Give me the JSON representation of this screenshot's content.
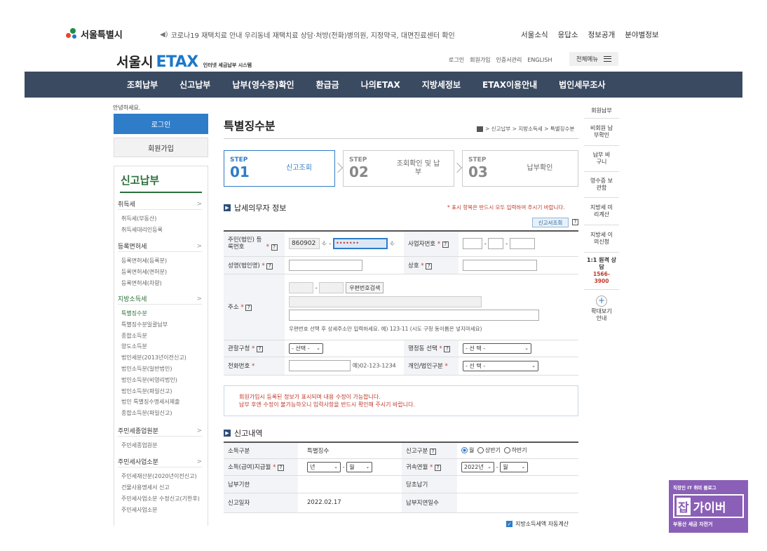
{
  "top": {
    "brand": "서울특별시",
    "notice": "코로나19 재택치료 안내 우리동네 재택치료 상담·처방(전화)병의원, 지정약국, 대면진료센터 확인",
    "nav": [
      "서울소식",
      "응답소",
      "정보공개",
      "분야별정보"
    ]
  },
  "etax": {
    "logo_k": "서울시",
    "logo_e": "ETAX",
    "logo_sub": "인터넷 세금납부 시스템",
    "links": [
      "로그인",
      "회원가입",
      "인증서관리",
      "ENGLISH"
    ],
    "all_menu": "전체메뉴"
  },
  "main_nav": [
    "조회납부",
    "신고납부",
    "납부(영수증)확인",
    "환급금",
    "나의ETAX",
    "지방세정보",
    "ETAX이용안내",
    "법인세무조사"
  ],
  "sidebar": {
    "greeting": "안녕하세요.",
    "login": "로그인",
    "join": "회원가입",
    "title": "신고납부",
    "groups": [
      {
        "label": "취득세",
        "items": [
          "취득세(부동산)",
          "취득세대리인등록"
        ]
      },
      {
        "label": "등록면허세",
        "items": [
          "등록면허세(등록분)",
          "등록면허세(면허분)",
          "등록면허세(차량)"
        ]
      },
      {
        "label": "지방소득세",
        "items": [
          "특별징수분",
          "특별징수분일괄납부",
          "종합소득분",
          "양도소득분",
          "법인세분(2013년이전신고)",
          "법인소득분(일반법인)",
          "법인소득분(비영리법인)",
          "법인소득분(파일신고)",
          "법인 특별징수명세서제출",
          "종합소득분(파일신고)"
        ]
      },
      {
        "label": "주민세종업원분",
        "items": [
          "주민세종업원분"
        ]
      },
      {
        "label": "주민세사업소분",
        "items": [
          "주민세재산분(2020년이전신고)",
          "건물사용명세서 신고",
          "주민세사업소분 수정신고(기한후)",
          "주민세사업소분"
        ]
      }
    ]
  },
  "quick": [
    "회원납부",
    "비회원 납부확인",
    "납부 바구니",
    "영수증 보관함",
    "지방세 미리계산",
    "지방세 이의신청",
    "1:1 원격 상담"
  ],
  "quick_phone": "1566-3900",
  "quick_zoom": "확대보기 안내",
  "content": {
    "title": "특별징수분",
    "breadcrumb": "> 신고납부 > 지방소득세 > 특별징수분",
    "steps": [
      {
        "label": "STEP",
        "num": "01",
        "text": "신고조회"
      },
      {
        "label": "STEP",
        "num": "02",
        "text": "조회확인 및 납부"
      },
      {
        "label": "STEP",
        "num": "03",
        "text": "납부확인"
      }
    ],
    "sec1": "납세의무자 정보",
    "required_note": "* 표시 항목은 반드시 모두 입력하여 주시기 바랍니다.",
    "lookup": "신고서조회",
    "form": {
      "rrn_label": "주민(법인) 등록번호",
      "rrn_front": "860902",
      "rrn_back": "•••••••",
      "biz_label": "사업자번호",
      "name_label": "성명(법인명)",
      "firm_label": "상호",
      "addr_label": "주소",
      "zip_btn": "우편번호검색",
      "addr_help": "우편번호 선택 후 상세주소만 입력하세요. 예) 123-11 (시도 구청 동이름은 넣지마세요)",
      "district_label": "관할구청",
      "district_sel": "- 선택 -",
      "dong_label": "행정동 선택",
      "dong_sel": "- 선 택 -",
      "phone_label": "전화번호",
      "phone_example": "예)02-123-1234",
      "type_label": "개인/법인구분",
      "type_sel": "- 선 택 -"
    },
    "notice_lines": [
      "회원가입시 등록된 정보가 표시되며 내용 수정이 가능합니다.",
      "납부 후엔 수정이 불가능하오니 입력사항을 반드시 확인해 주시기 바랍니다."
    ],
    "sec2": "신고내역",
    "report": {
      "income_type_label": "소득구분",
      "income_type": "특별징수",
      "report_type_label": "신고구분",
      "radio_month": "월",
      "radio_h1": "상반기",
      "radio_h2": "하반기",
      "pay_month_label": "소득(급여)지급월",
      "year_sel": "년",
      "month_sel": "월",
      "belong_label": "귀속연월",
      "belong_year": "2022년",
      "belong_month": "월",
      "due_label": "납부기한",
      "due_year_label": "당초납기",
      "report_date_label": "신고일자",
      "report_date": "2022.02.17",
      "late_days_label": "납부지연일수"
    },
    "auto_calc": "지방소득세액 자동계산"
  },
  "badge": {
    "top": "직장인 IT 취미 블로그",
    "jab": "잡",
    "gaiver": "가이버",
    "bottom": "부동산 세금 자전거"
  },
  "colors": {
    "nav_bg": "#3a4a61",
    "accent": "#2f7cc8",
    "green": "#2a6f3a",
    "required": "#c0392b",
    "badge": "#8a5fb7"
  }
}
